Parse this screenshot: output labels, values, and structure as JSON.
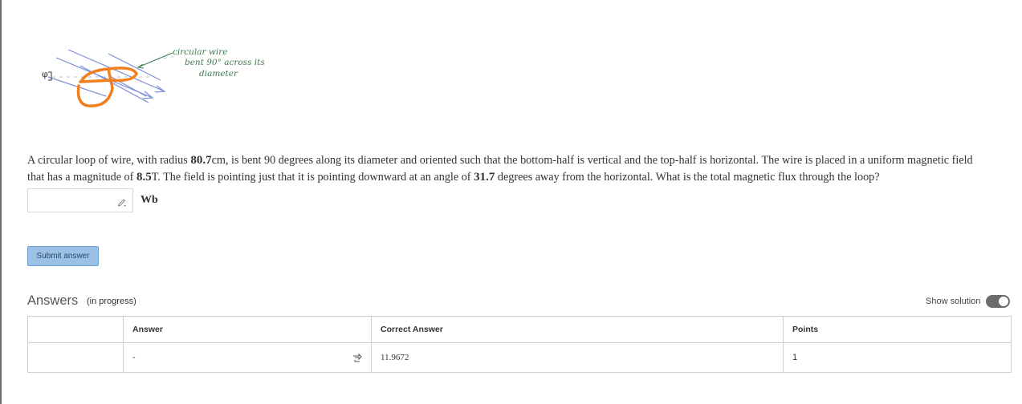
{
  "figure": {
    "annotation_lines": [
      "circular wire",
      "bent 90° across its",
      "diameter"
    ],
    "angle_symbol": "φ",
    "wire_color": "#f07f1e",
    "field_line_color": "#7a8fd6",
    "annotation_color": "#3f7a4d"
  },
  "question": {
    "part1": "A circular loop of wire, with radius ",
    "radius": "80.7",
    "part2": "cm, is bent 90 degrees along its diameter and oriented such that the bottom-half is vertical and the top-half is horizontal. The wire is placed in a uniform magnetic field that has a magnitude of ",
    "field": "8.5",
    "part3": "T. The field is pointing just that it is pointing downward at an angle of ",
    "angle": "31.7",
    "part4": " degrees away from the horizontal. What is the total magnetic flux through the loop?"
  },
  "answer_input": {
    "value": "",
    "placeholder": "",
    "unit": "Wb",
    "icon": "pencil-icon"
  },
  "submit": {
    "label": "Submit answer",
    "color": "#9bc2e6"
  },
  "answers": {
    "heading": "Answers",
    "status": "(in progress)",
    "show_solution_label": "Show solution",
    "columns": [
      "",
      "Answer",
      "Correct Answer",
      "Points"
    ],
    "rows": [
      {
        "index": "",
        "answer": "-",
        "correct": "11.9672",
        "points": "1"
      }
    ]
  }
}
